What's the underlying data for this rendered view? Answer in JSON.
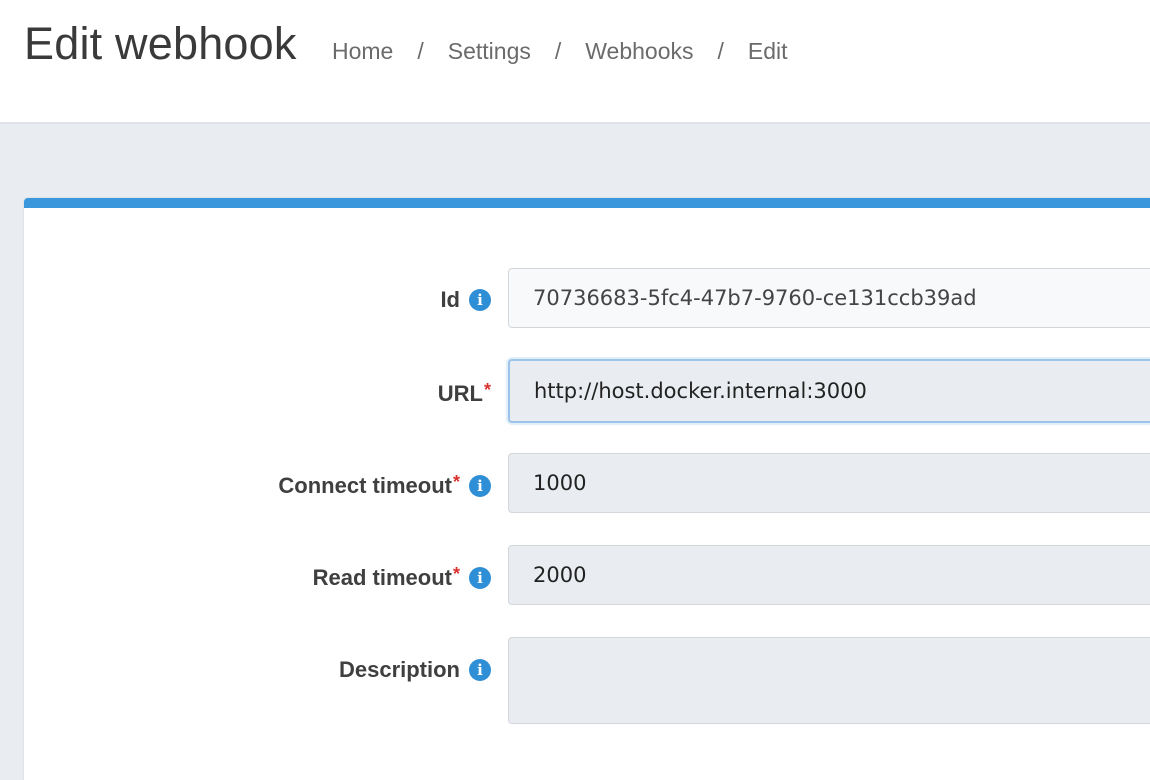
{
  "header": {
    "title": "Edit webhook",
    "breadcrumb": [
      {
        "label": "Home"
      },
      {
        "label": "Settings"
      },
      {
        "label": "Webhooks"
      },
      {
        "label": "Edit"
      }
    ],
    "separator": "/"
  },
  "form": {
    "accent_color": "#3b97dc",
    "fields": {
      "id": {
        "label": "Id",
        "value": "70736683-5fc4-47b7-9760-ce131ccb39ad",
        "required": false,
        "info": true
      },
      "url": {
        "label": "URL",
        "value": "http://host.docker.internal:3000",
        "required": true,
        "info": false
      },
      "connect_timeout": {
        "label": "Connect timeout",
        "value": "1000",
        "required": true,
        "info": true
      },
      "read_timeout": {
        "label": "Read timeout",
        "value": "2000",
        "required": true,
        "info": true
      },
      "description": {
        "label": "Description",
        "value": "",
        "required": false,
        "info": true
      }
    },
    "required_marker": "*",
    "info_glyph": "i"
  }
}
